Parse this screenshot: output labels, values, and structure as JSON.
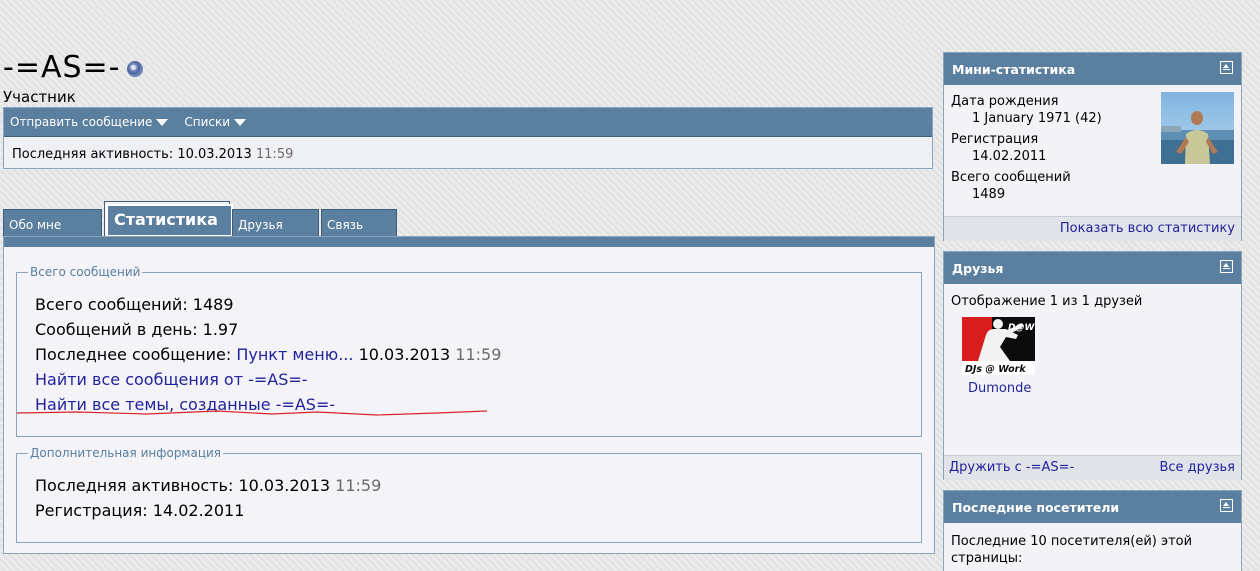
{
  "profile": {
    "username": "-=AS=-",
    "title": "Участник",
    "actions": {
      "send_message": "Отправить сообщение",
      "lists": "Списки"
    },
    "last_activity_label": "Последняя активность:",
    "last_activity_date": "10.03.2013",
    "last_activity_time": "11:59"
  },
  "tabs": [
    {
      "label": "Обо мне"
    },
    {
      "label": "Статистика"
    },
    {
      "label": "Друзья"
    },
    {
      "label": "Связь"
    }
  ],
  "stats": {
    "legend": "Всего сообщений",
    "total_posts": "Всего сообщений: 1489",
    "posts_per_day": "Сообщений в день: 1.97",
    "last_post_label": "Последнее сообщение:",
    "last_post_link": "Пункт меню...",
    "last_post_date": "10.03.2013",
    "last_post_time": "11:59",
    "find_posts": "Найти все сообщения от -=AS=-",
    "find_threads": "Найти все темы, созданные -=AS=-"
  },
  "additional": {
    "legend": "Дополнительная информация",
    "last_activity_label": "Последняя активность:",
    "last_activity_date": "10.03.2013",
    "last_activity_time": "11:59",
    "registration": "Регистрация: 14.02.2011"
  },
  "mini_stats": {
    "title": "Мини-статистика",
    "birthday_label": "Дата рождения",
    "birthday_value": "1 January 1971 (42)",
    "registration_label": "Регистрация",
    "registration_value": "14.02.2011",
    "posts_label": "Всего сообщений",
    "posts_value": "1489",
    "show_all": "Показать всю статистику"
  },
  "friends": {
    "title": "Друзья",
    "showing": "Отображение 1 из 1 друзей",
    "friend_name": "Dumonde",
    "friend_logo_top": "D@W",
    "friend_logo_bottom": "DJs @ Work",
    "befriend": "Дружить с -=AS=-",
    "all_friends": "Все друзья"
  },
  "visitors": {
    "title": "Последние посетители",
    "text": "Последние 10 посетителя(ей) этой страницы:"
  },
  "colors": {
    "header_bar": "#5a7f9f",
    "link": "#22229c",
    "underline": "#d8232a"
  }
}
